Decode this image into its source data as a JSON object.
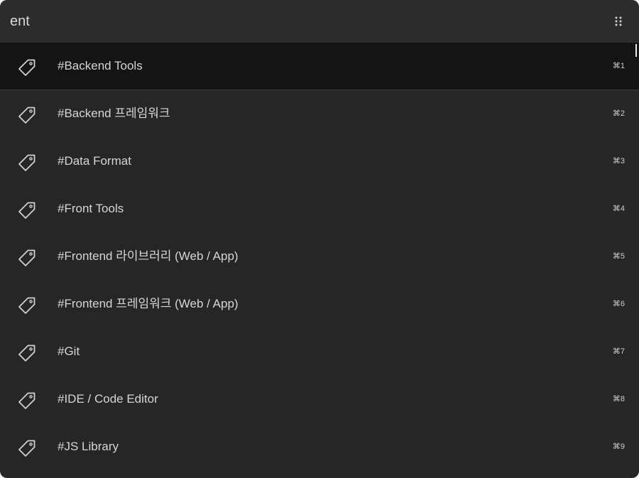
{
  "search": {
    "value": "ent",
    "placeholder": ""
  },
  "menu": {
    "icon": "grip-dots-icon"
  },
  "results": [
    {
      "icon": "tag-icon",
      "label": "#Backend Tools",
      "shortcut": "⌘1",
      "selected": true
    },
    {
      "icon": "tag-icon",
      "label": "#Backend 프레임워크",
      "shortcut": "⌘2",
      "selected": false
    },
    {
      "icon": "tag-icon",
      "label": "#Data Format",
      "shortcut": "⌘3",
      "selected": false
    },
    {
      "icon": "tag-icon",
      "label": "#Front Tools",
      "shortcut": "⌘4",
      "selected": false
    },
    {
      "icon": "tag-icon",
      "label": "#Frontend 라이브러리 (Web / App)",
      "shortcut": "⌘5",
      "selected": false
    },
    {
      "icon": "tag-icon",
      "label": "#Frontend 프레임워크 (Web / App)",
      "shortcut": "⌘6",
      "selected": false
    },
    {
      "icon": "tag-icon",
      "label": "#Git",
      "shortcut": "⌘7",
      "selected": false
    },
    {
      "icon": "tag-icon",
      "label": "#IDE / Code Editor",
      "shortcut": "⌘8",
      "selected": false
    },
    {
      "icon": "tag-icon",
      "label": "#JS Library",
      "shortcut": "⌘9",
      "selected": false
    }
  ],
  "colors": {
    "panel_bg": "#262626",
    "search_bg": "#2c2c2c",
    "selected_bg": "#141414",
    "text": "#d6d6d6"
  }
}
